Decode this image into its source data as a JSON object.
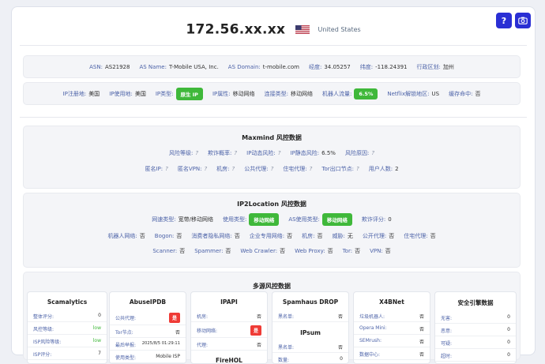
{
  "header": {
    "ip": "172.56.xx.xx",
    "country": "United States"
  },
  "asn_row": [
    {
      "label": "ASN:",
      "value": "AS21928"
    },
    {
      "label": "AS Name:",
      "value": "T-Mobile USA, Inc."
    },
    {
      "label": "AS Domain:",
      "value": "t-mobile.com"
    },
    {
      "label": "经度:",
      "value": "34.05257"
    },
    {
      "label": "纬度:",
      "value": "-118.24391"
    },
    {
      "label": "行政区划:",
      "value": "加州"
    }
  ],
  "ip_row": {
    "reg_label": "IP注册地:",
    "reg_value": "美国",
    "use_label": "IP使用地:",
    "use_value": "美国",
    "type_label": "IP类型:",
    "type_value": "原生 IP",
    "attr_label": "IP属性:",
    "attr_value": "移动网络",
    "conn_label": "连接类型:",
    "conn_value": "移动网络",
    "bot_label": "机器人流量:",
    "bot_value": "6.5%",
    "netflix_label": "Netflix解锁地区:",
    "netflix_value": "US",
    "cache_label": "缓存命中:",
    "cache_value": "否"
  },
  "maxmind": {
    "title": "Maxmind 风控数据",
    "row1": [
      {
        "label": "风险等级:",
        "value": "?"
      },
      {
        "label": "欺诈概率:",
        "value": "?"
      },
      {
        "label": "IP动态风险:",
        "value": "?"
      },
      {
        "label": "IP静态风险:",
        "value": "6.5%"
      },
      {
        "label": "风险原因:",
        "value": "?"
      }
    ],
    "row2": [
      {
        "label": "匿名IP:",
        "value": "?"
      },
      {
        "label": "匿名VPN:",
        "value": "?"
      },
      {
        "label": "机房:",
        "value": "?"
      },
      {
        "label": "公共代理:",
        "value": "?"
      },
      {
        "label": "住宅代理:",
        "value": "?"
      },
      {
        "label": "Tor出口节点:",
        "value": "?"
      },
      {
        "label": "用户人数:",
        "value": "2"
      }
    ]
  },
  "ip2location": {
    "title": "IP2Location 风控数据",
    "row1": {
      "speed_label": "网速类型:",
      "speed_value": "宽带/移动网络",
      "use_label": "使用类型:",
      "use_value": "移动网络",
      "as_label": "AS使用类型:",
      "as_value": "移动网络",
      "fraud_label": "欺诈评分:",
      "fraud_value": "0"
    },
    "row2": [
      {
        "label": "机器人网络:",
        "value": "否"
      },
      {
        "label": "Bogon:",
        "value": "否"
      },
      {
        "label": "消费者隐私网络:",
        "value": "否"
      },
      {
        "label": "企业专用网络:",
        "value": "否"
      },
      {
        "label": "机房:",
        "value": "否"
      },
      {
        "label": "威胁:",
        "value": "无"
      },
      {
        "label": "公开代理:",
        "value": "否"
      },
      {
        "label": "住宅代理:",
        "value": "否"
      }
    ],
    "row3": [
      {
        "label": "Scanner:",
        "value": "否"
      },
      {
        "label": "Spammer:",
        "value": "否"
      },
      {
        "label": "Web Crawler:",
        "value": "否"
      },
      {
        "label": "Web Proxy:",
        "value": "否"
      },
      {
        "label": "Tor:",
        "value": "否"
      },
      {
        "label": "VPN:",
        "value": "否"
      }
    ]
  },
  "multi": {
    "title": "多源风控数据",
    "scamalytics": {
      "title": "Scamalytics",
      "rows": [
        {
          "k": "整体评分:",
          "v": "0"
        },
        {
          "k": "风控等级:",
          "v": "low"
        },
        {
          "k": "ISP风险等级:",
          "v": "low"
        },
        {
          "k": "ISP评分:",
          "v": "7"
        }
      ]
    },
    "abuseipdb": {
      "title": "AbuseIPDB",
      "rows": [
        {
          "k": "公共代理:",
          "v": "是"
        },
        {
          "k": "Tor节点:",
          "v": "否"
        },
        {
          "k": "最后举报:",
          "v": "2025/8/5 01:29:11"
        },
        {
          "k": "使用类型:",
          "v": "Mobile ISP"
        }
      ]
    },
    "ipapi": {
      "title": "IPAPI",
      "rows": [
        {
          "k": "机房:",
          "v": "否"
        },
        {
          "k": "移动网络:",
          "v": "是"
        },
        {
          "k": "代理:",
          "v": "否"
        }
      ],
      "sub_title": "FireHOL"
    },
    "spamhaus": {
      "title": "Spamhaus DROP",
      "rows": [
        {
          "k": "黑名单:",
          "v": "否"
        }
      ],
      "sub_title": "IPsum",
      "sub_rows": [
        {
          "k": "黑名单:",
          "v": "否"
        },
        {
          "k": "数量:",
          "v": "0"
        }
      ]
    },
    "x4bnet": {
      "title": "X4BNet",
      "rows": [
        {
          "k": "垃圾机器人:",
          "v": "否"
        },
        {
          "k": "Opera Mini:",
          "v": "否"
        },
        {
          "k": "SEMrush:",
          "v": "否"
        },
        {
          "k": "数据中心:",
          "v": "否"
        }
      ]
    },
    "security": {
      "title": "安全引擎数据",
      "rows": [
        {
          "k": "无害:",
          "v": "0"
        },
        {
          "k": "恶意:",
          "v": "0"
        },
        {
          "k": "可疑:",
          "v": "0"
        },
        {
          "k": "超时:",
          "v": "0"
        }
      ]
    }
  },
  "colors": {
    "accent": "#2a2fd4",
    "badge_green": "#3fb83a",
    "badge_red": "#ef3b36",
    "label_blue": "#4d63a8"
  },
  "icons": [
    "help-icon",
    "camera-icon",
    "us-flag-icon"
  ]
}
